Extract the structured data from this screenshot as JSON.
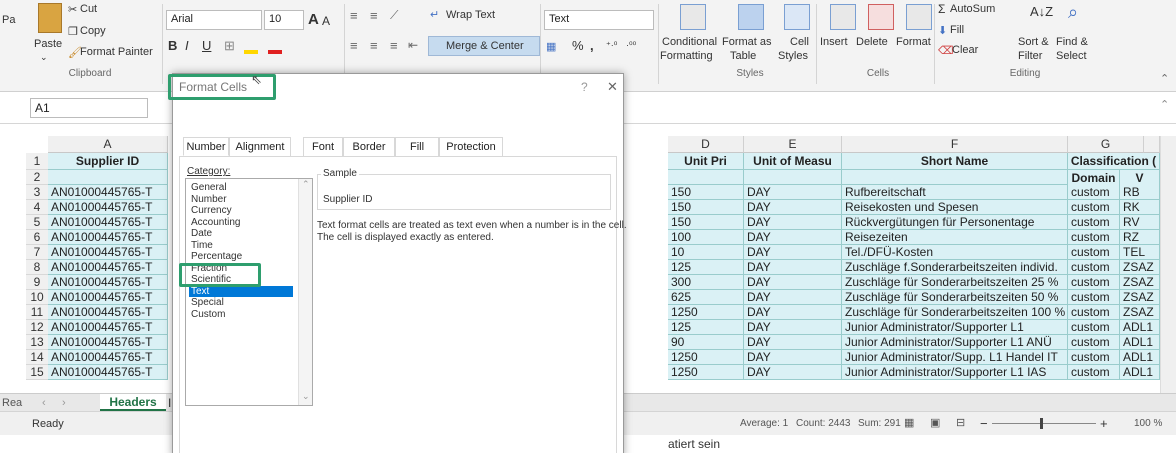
{
  "ribbon": {
    "clipboard": {
      "paste": "Paste",
      "cut": "Cut",
      "copy": "Copy",
      "format_painter": "Format Painter",
      "group": "Clipboard",
      "partial_left": "Pa"
    },
    "font": {
      "name": "Arial",
      "size": "10",
      "bold": "B",
      "italic": "I",
      "underline": "U",
      "grow": "A",
      "shrink": "A"
    },
    "alignment": {
      "wrap_text": "Wrap Text",
      "merge_center": "Merge & Center"
    },
    "number": {
      "format": "Text",
      "percent": "%",
      "comma": ","
    },
    "styles": {
      "conditional": "Conditional",
      "formatting": "Formatting",
      "format_as": "Format as",
      "table": "Table",
      "cell": "Cell",
      "cell_styles": "Styles",
      "group": "Styles"
    },
    "cells": {
      "insert": "Insert",
      "delete": "Delete",
      "format": "Format",
      "group": "Cells"
    },
    "editing": {
      "autosum": "AutoSum",
      "fill": "Fill",
      "clear": "Clear",
      "sort_filter": "Sort &",
      "filter": "Filter",
      "find_select": "Find &",
      "select": "Select",
      "group": "Editing"
    }
  },
  "formula_bar": {
    "name_box": "A1"
  },
  "columns": {
    "a": "A",
    "d": "D",
    "e": "E",
    "f": "F",
    "g": "G"
  },
  "headers": {
    "row_num": "1",
    "supplier_id": "Supplier ID",
    "unit_price": "Unit Pri",
    "unit_measure": "Unit of Measu",
    "short_name": "Short Name",
    "classification": "Classification (",
    "domain": "Domain",
    "v_partial": "V"
  },
  "rows": [
    {
      "num": "2",
      "a": "",
      "d": "",
      "e": "",
      "f": "",
      "g": "",
      "h": ""
    },
    {
      "num": "3",
      "a": "AN01000445765-T",
      "d": "150",
      "e": "DAY",
      "f": "Rufbereitschaft",
      "g": "custom",
      "h": "RB"
    },
    {
      "num": "4",
      "a": "AN01000445765-T",
      "d": "150",
      "e": "DAY",
      "f": "Reisekosten und Spesen",
      "g": "custom",
      "h": "RK"
    },
    {
      "num": "5",
      "a": "AN01000445765-T",
      "d": "150",
      "e": "DAY",
      "f": "Rückvergütungen für Personentage",
      "g": "custom",
      "h": "RV"
    },
    {
      "num": "6",
      "a": "AN01000445765-T",
      "d": "100",
      "e": "DAY",
      "f": "Reisezeiten",
      "g": "custom",
      "h": "RZ"
    },
    {
      "num": "7",
      "a": "AN01000445765-T",
      "d": "10",
      "e": "DAY",
      "f": "Tel./DFÜ-Kosten",
      "g": "custom",
      "h": "TEL"
    },
    {
      "num": "8",
      "a": "AN01000445765-T",
      "d": "125",
      "e": "DAY",
      "f": "Zuschläge f.Sonderarbeitszeiten individ.",
      "g": "custom",
      "h": "ZSAZ"
    },
    {
      "num": "9",
      "a": "AN01000445765-T",
      "d": "300",
      "e": "DAY",
      "f": "Zuschläge für Sonderarbeitszeiten 25 %",
      "g": "custom",
      "h": "ZSAZ"
    },
    {
      "num": "10",
      "a": "AN01000445765-T",
      "d": "625",
      "e": "DAY",
      "f": "Zuschläge für Sonderarbeitszeiten 50 %",
      "g": "custom",
      "h": "ZSAZ"
    },
    {
      "num": "11",
      "a": "AN01000445765-T",
      "d": "1250",
      "e": "DAY",
      "f": "Zuschläge für Sonderarbeitszeiten 100 %",
      "g": "custom",
      "h": "ZSAZ"
    },
    {
      "num": "12",
      "a": "AN01000445765-T",
      "d": "125",
      "e": "DAY",
      "f": "Junior Administrator/Supporter L1",
      "g": "custom",
      "h": "ADL1"
    },
    {
      "num": "13",
      "a": "AN01000445765-T",
      "d": "90",
      "e": "DAY",
      "f": "Junior Administrator/Supporter L1 ANÜ",
      "g": "custom",
      "h": "ADL1"
    },
    {
      "num": "14",
      "a": "AN01000445765-T",
      "d": "1250",
      "e": "DAY",
      "f": "Junior Administrator/Supp. L1 Handel IT",
      "g": "custom",
      "h": "ADL1"
    },
    {
      "num": "15",
      "a": "AN01000445765-T",
      "d": "1250",
      "e": "DAY",
      "f": "Junior Administrator/Supporter L1 IAS",
      "g": "custom",
      "h": "ADL1"
    }
  ],
  "sheet_tabs": {
    "headers": "Headers",
    "partial_left": "Rea",
    "partial_right": "I"
  },
  "status": {
    "ready": "Ready",
    "average": "Average: 1",
    "count": "Count: 2443",
    "sum": "Sum: 291",
    "zoom": "100 %",
    "minus": "−",
    "plus": "+"
  },
  "below_text": "atiert sein",
  "dialog": {
    "title": "Format Cells",
    "help": "?",
    "close": "✕",
    "tabs": [
      "Number",
      "Alignment",
      "Font",
      "Border",
      "Fill",
      "Protection"
    ],
    "category_label": "Category:",
    "categories": [
      "General",
      "Number",
      "Currency",
      "Accounting",
      "Date",
      "Time",
      "Percentage",
      "Fraction",
      "Scientific",
      "Text",
      "Special",
      "Custom"
    ],
    "selected_category": "Text",
    "sample_label": "Sample",
    "sample_value": "Supplier ID",
    "description_line1": "Text format cells are treated as text even when a number is in the cell.",
    "description_line2": "The cell is displayed exactly as entered."
  },
  "colors": {
    "highlight": "#2e9e6e",
    "selection": "#0078d7",
    "cell_fill": "#daf1f5"
  }
}
